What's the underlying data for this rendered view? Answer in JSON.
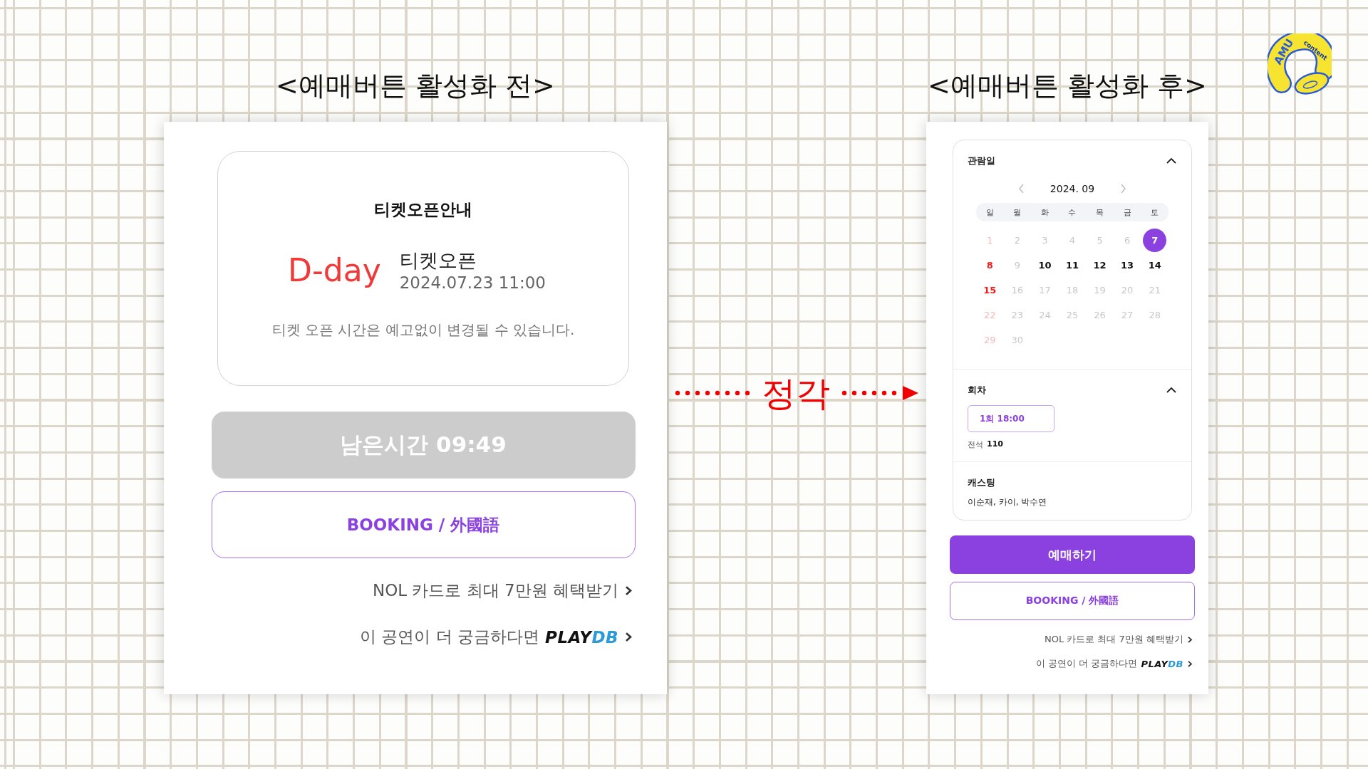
{
  "before": {
    "heading": "<예매버튼 활성화 전>",
    "notice": {
      "title": "티켓오픈안내",
      "dday": "D-day",
      "label": "티켓오픈",
      "datetime": "2024.07.23 11:00",
      "note": "티켓 오픈 시간은 예고없이 변경될 수 있습니다."
    },
    "main_button": {
      "label": "남은시간 09:49",
      "disabled": true
    },
    "booking_button": {
      "label": "BOOKING / 外國語"
    },
    "links": [
      {
        "text": "NOL 카드로 최대 7만원 혜택받기"
      },
      {
        "text": "이 공연이 더 궁금하다면",
        "logo": {
          "part_1": "PLAY",
          "part_2": "DB"
        }
      }
    ]
  },
  "transition": {
    "label": "정각"
  },
  "after": {
    "heading": "<예매버튼 활성화 후>",
    "date_section": {
      "title": "관람일",
      "expanded": true,
      "month": "2024. 09",
      "weekdays": [
        "일",
        "월",
        "화",
        "수",
        "목",
        "금",
        "토"
      ],
      "days": [
        {
          "day": "1",
          "available": false,
          "selected": false
        },
        {
          "day": "2",
          "available": false,
          "selected": false
        },
        {
          "day": "3",
          "available": false,
          "selected": false
        },
        {
          "day": "4",
          "available": false,
          "selected": false
        },
        {
          "day": "5",
          "available": false,
          "selected": false
        },
        {
          "day": "6",
          "available": false,
          "selected": false
        },
        {
          "day": "7",
          "available": true,
          "selected": true
        },
        {
          "day": "8",
          "available": true,
          "selected": false
        },
        {
          "day": "9",
          "available": false,
          "selected": false
        },
        {
          "day": "10",
          "available": true,
          "selected": false
        },
        {
          "day": "11",
          "available": true,
          "selected": false
        },
        {
          "day": "12",
          "available": true,
          "selected": false
        },
        {
          "day": "13",
          "available": true,
          "selected": false
        },
        {
          "day": "14",
          "available": true,
          "selected": false
        },
        {
          "day": "15",
          "available": true,
          "selected": false
        },
        {
          "day": "16",
          "available": false,
          "selected": false
        },
        {
          "day": "17",
          "available": false,
          "selected": false
        },
        {
          "day": "18",
          "available": false,
          "selected": false
        },
        {
          "day": "19",
          "available": false,
          "selected": false
        },
        {
          "day": "20",
          "available": false,
          "selected": false
        },
        {
          "day": "21",
          "available": false,
          "selected": false
        },
        {
          "day": "22",
          "available": false,
          "selected": false
        },
        {
          "day": "23",
          "available": false,
          "selected": false
        },
        {
          "day": "24",
          "available": false,
          "selected": false
        },
        {
          "day": "25",
          "available": false,
          "selected": false
        },
        {
          "day": "26",
          "available": false,
          "selected": false
        },
        {
          "day": "27",
          "available": false,
          "selected": false
        },
        {
          "day": "28",
          "available": false,
          "selected": false
        },
        {
          "day": "29",
          "available": false,
          "selected": false
        },
        {
          "day": "30",
          "available": false,
          "selected": false
        }
      ]
    },
    "session_section": {
      "title": "회차",
      "expanded": true,
      "sessions": [
        {
          "label": "1회  18:00",
          "selected": true
        }
      ],
      "seats_label": "전석",
      "seats_count": "110"
    },
    "casting_section": {
      "title": "캐스팅",
      "cast": "이순재, 카이, 박수연"
    },
    "main_button": {
      "label": "예매하기",
      "disabled": false
    },
    "booking_button": {
      "label": "BOOKING / 外國語"
    },
    "links": [
      {
        "text": "NOL 카드로 최대 7만원 혜택받기"
      },
      {
        "text": "이 공연이 더 궁금하다면",
        "logo": {
          "part_1": "PLAY",
          "part_2": "DB"
        }
      }
    ]
  },
  "logo": {
    "text_1": "AMU",
    "text_2": "content"
  }
}
